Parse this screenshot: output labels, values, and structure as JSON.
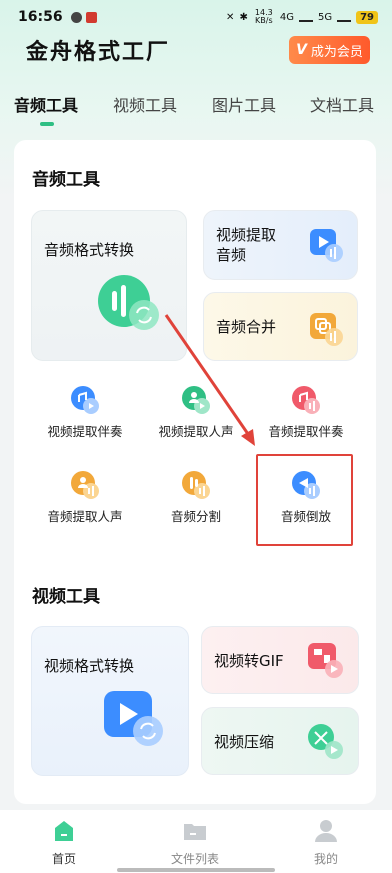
{
  "status_bar": {
    "time": "16:56",
    "net_speed": "14.3 KB/s",
    "signal_1": "4G",
    "signal_2": "5G",
    "battery": "79"
  },
  "header": {
    "app_title": "金舟格式工厂",
    "vip_button_label": "成为会员",
    "vip_badge": "V"
  },
  "tabs": [
    {
      "label": "音频工具",
      "active": true
    },
    {
      "label": "视频工具",
      "active": false
    },
    {
      "label": "图片工具",
      "active": false
    },
    {
      "label": "文档工具",
      "active": false
    }
  ],
  "audio_section": {
    "title": "音频工具",
    "big_tile": {
      "label": "音频格式转换"
    },
    "side_tiles": [
      {
        "label_line1": "视频提取",
        "label_line2": "音频"
      },
      {
        "label_line1": "音频合并",
        "label_line2": ""
      }
    ],
    "grid": [
      {
        "label": "视频提取伴奏",
        "icon": "video-extract-accompaniment-icon",
        "color": "#3c8dff"
      },
      {
        "label": "视频提取人声",
        "icon": "video-extract-vocal-icon",
        "color": "#2fbf84"
      },
      {
        "label": "音频提取伴奏",
        "icon": "audio-extract-accompaniment-icon",
        "color": "#f05a6a"
      },
      {
        "label": "音频提取人声",
        "icon": "audio-extract-vocal-icon",
        "color": "#f2a83a"
      },
      {
        "label": "音频分割",
        "icon": "audio-split-icon",
        "color": "#f2a83a"
      },
      {
        "label": "音频倒放",
        "icon": "audio-reverse-icon",
        "color": "#3c8dff"
      }
    ]
  },
  "video_section": {
    "title": "视频工具",
    "big_tile": {
      "label": "视频格式转换"
    },
    "side_tiles": [
      {
        "label": "视频转GIF"
      },
      {
        "label": "视频压缩"
      }
    ]
  },
  "bottom_nav": [
    {
      "label": "首页",
      "active": true
    },
    {
      "label": "文件列表",
      "active": false
    },
    {
      "label": "我的",
      "active": false
    }
  ],
  "colors": {
    "accent_green": "#2fbf84",
    "vip_orange": "#ff6a36",
    "highlight_red": "#e0433a"
  }
}
